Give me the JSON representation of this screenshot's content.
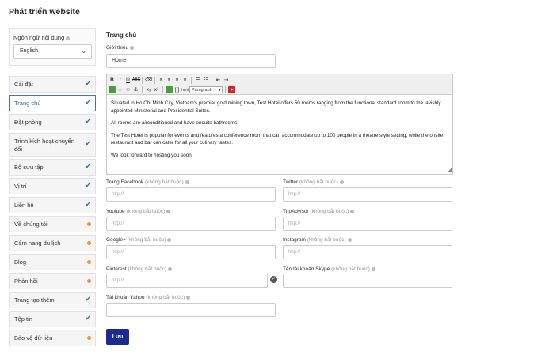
{
  "page_title": "Phát triển website",
  "language": {
    "label": "Ngôn ngữ nội dung",
    "selected": "English",
    "chevron_glyph": "⌄"
  },
  "menu": [
    {
      "label": "Cài đặt",
      "status": "check"
    },
    {
      "label": "Trang chủ",
      "status": "check",
      "active": true
    },
    {
      "label": "Đặt phòng",
      "status": "check"
    },
    {
      "label": "Trình kích hoạt chuyển đổi",
      "status": "check"
    },
    {
      "label": "Bộ sưu tập",
      "status": "check"
    },
    {
      "label": "Vị trí",
      "status": "check"
    },
    {
      "label": "Liên hệ",
      "status": "check"
    },
    {
      "label": "Về chúng tôi",
      "status": "pending"
    },
    {
      "label": "Cẩm nang du lịch",
      "status": "pending"
    },
    {
      "label": "Blog",
      "status": "pending"
    },
    {
      "label": "Phản hồi",
      "status": "pending"
    },
    {
      "label": "Trang tạo thêm",
      "status": "check"
    },
    {
      "label": "Tệp tin",
      "status": "check"
    },
    {
      "label": "Bảo vệ dữ liệu",
      "status": "pending"
    }
  ],
  "main": {
    "section_title": "Trang chủ",
    "intro_label": "Giới thiệu",
    "intro_value": "Home",
    "editor": {
      "format_value": "Paragraph",
      "paragraphs": [
        "Situated in Ho Chi Minh City, Vietnam's premier gold mining town, Test Hotel offers 50 rooms ranging from the functional standard room to the lavishly appointed Ministerial and Presidential Suites.",
        "All rooms are airconditioned and have ensuite bathrooms.",
        "The Test Hotel is popular for events and features a conference room that can accommodate up to 100 people in a theatre style setting, while the onsite restaurant and bar can cater for all your culinary tastes.",
        "We look forward to hosting you soon."
      ]
    },
    "optional_text": "(không bắt buộc)",
    "url_placeholder": "http://",
    "social_fields": {
      "facebook": "Trang Facebook",
      "twitter": "Twitter",
      "youtube": "Youtube",
      "tripadvisor": "TripAdvisor",
      "googleplus": "Google+",
      "instagram": "Instagram",
      "pinterest": "Pinterest",
      "skype": "Tên tài khoản Skype",
      "yahoo": "Tài khoản Yahoo"
    },
    "save_label": "Lưu"
  },
  "icons": {
    "check_glyph": "✔",
    "ok_glyph": "✓",
    "resize_glyph": "◢"
  },
  "colors": {
    "active_border": "#3d77b7",
    "pending_dot": "#f0953a",
    "save_button": "#1d2b8c"
  }
}
